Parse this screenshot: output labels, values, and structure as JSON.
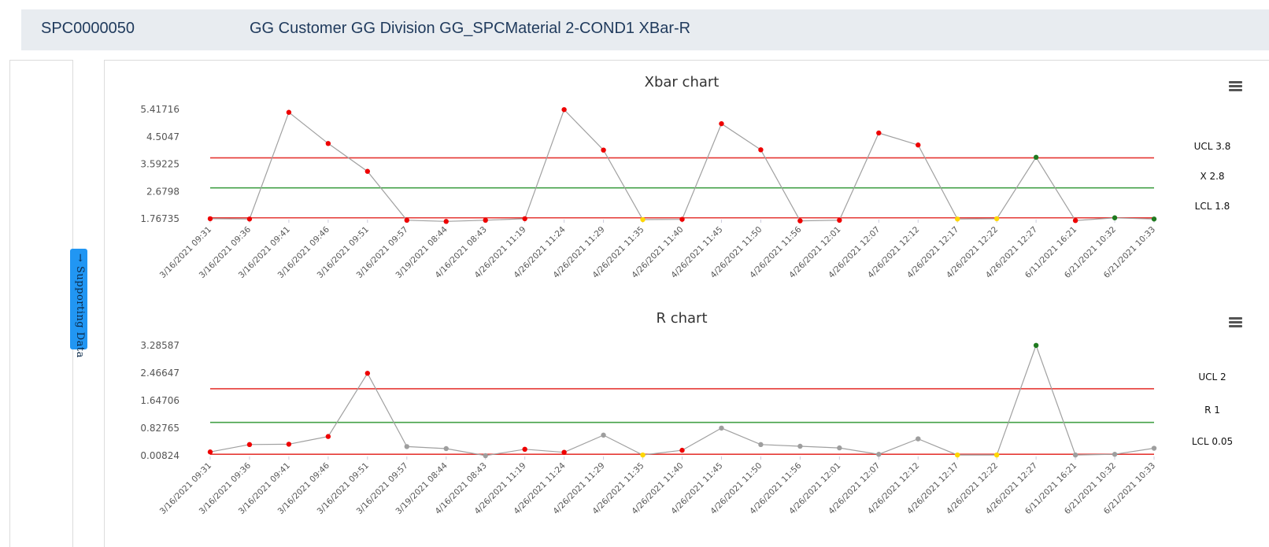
{
  "header": {
    "code": "SPC0000050",
    "title": "GG Customer GG Division GG_SPCMaterial 2-COND1 XBar-R"
  },
  "side_tab": {
    "label": "→ Supporting Data"
  },
  "colors": {
    "ucl_lcl_line": "#e53935",
    "center_line": "#43a047",
    "series_line": "#a0a0a0",
    "point_red": "#ee0000",
    "point_yellow": "#ffd700",
    "point_green": "#1f7a1f",
    "point_gray": "#9e9e9e"
  },
  "chart_data": [
    {
      "type": "line",
      "title": "Xbar chart",
      "menu_icon": "hamburger-menu-icon",
      "categories": [
        "3/16/2021 09:31",
        "3/16/2021 09:36",
        "3/16/2021 09:41",
        "3/16/2021 09:46",
        "3/16/2021 09:51",
        "3/16/2021 09:57",
        "3/19/2021 08:44",
        "4/16/2021 08:43",
        "4/26/2021 11:19",
        "4/26/2021 11:24",
        "4/26/2021 11:29",
        "4/26/2021 11:35",
        "4/26/2021 11:40",
        "4/26/2021 11:45",
        "4/26/2021 11:50",
        "4/26/2021 11:56",
        "4/26/2021 12:01",
        "4/26/2021 12:07",
        "4/26/2021 12:12",
        "4/26/2021 12:17",
        "4/26/2021 12:22",
        "4/26/2021 12:27",
        "6/11/2021 16:21",
        "6/21/2021 10:32",
        "6/21/2021 10:33"
      ],
      "values": [
        1.77,
        1.76,
        5.32,
        4.28,
        3.35,
        1.72,
        1.68,
        1.72,
        1.77,
        5.41,
        4.06,
        1.74,
        1.75,
        4.94,
        4.07,
        1.7,
        1.72,
        4.63,
        4.23,
        1.76,
        1.77,
        3.82,
        1.71,
        1.8,
        1.76
      ],
      "point_colors": [
        "red",
        "red",
        "red",
        "red",
        "red",
        "red",
        "red",
        "red",
        "red",
        "red",
        "red",
        "yellow",
        "red",
        "red",
        "red",
        "red",
        "red",
        "red",
        "red",
        "yellow",
        "yellow",
        "green",
        "red",
        "green",
        "green"
      ],
      "ytick_labels": [
        "5.41716",
        "4.5047",
        "3.59225",
        "2.6798",
        "1.76735"
      ],
      "ylim": [
        1.76735,
        5.41716
      ],
      "control_limits": [
        {
          "name": "UCL",
          "value": 3.8,
          "label": "UCL 3.8",
          "kind": "limit"
        },
        {
          "name": "X",
          "value": 2.8,
          "label": "X 2.8",
          "kind": "center"
        },
        {
          "name": "LCL",
          "value": 1.8,
          "label": "LCL 1.8",
          "kind": "limit"
        }
      ]
    },
    {
      "type": "line",
      "title": "R chart",
      "menu_icon": "hamburger-menu-icon",
      "categories": [
        "3/16/2021 09:31",
        "3/16/2021 09:36",
        "3/16/2021 09:41",
        "3/16/2021 09:46",
        "3/16/2021 09:51",
        "3/16/2021 09:57",
        "3/19/2021 08:44",
        "4/16/2021 08:43",
        "4/26/2021 11:19",
        "4/26/2021 11:24",
        "4/26/2021 11:29",
        "4/26/2021 11:35",
        "4/26/2021 11:40",
        "4/26/2021 11:45",
        "4/26/2021 11:50",
        "4/26/2021 11:56",
        "4/26/2021 12:01",
        "4/26/2021 12:07",
        "4/26/2021 12:12",
        "4/26/2021 12:17",
        "4/26/2021 12:22",
        "4/26/2021 12:27",
        "6/11/2021 16:21",
        "6/21/2021 10:32",
        "6/21/2021 10:33"
      ],
      "values": [
        0.12,
        0.34,
        0.35,
        0.58,
        2.46,
        0.28,
        0.22,
        0.01,
        0.2,
        0.11,
        0.62,
        0.03,
        0.17,
        0.83,
        0.34,
        0.29,
        0.24,
        0.05,
        0.51,
        0.03,
        0.03,
        3.29,
        0.03,
        0.05,
        0.23
      ],
      "point_colors": [
        "red",
        "red",
        "red",
        "red",
        "red",
        "gray",
        "gray",
        "gray",
        "red",
        "red",
        "gray",
        "yellow",
        "red",
        "gray",
        "gray",
        "gray",
        "gray",
        "gray",
        "gray",
        "yellow",
        "yellow",
        "green",
        "gray",
        "gray",
        "gray"
      ],
      "ytick_labels": [
        "3.28587",
        "2.46647",
        "1.64706",
        "0.82765",
        "0.00824"
      ],
      "ylim": [
        0.00824,
        3.28587
      ],
      "control_limits": [
        {
          "name": "UCL",
          "value": 2,
          "label": "UCL 2",
          "kind": "limit"
        },
        {
          "name": "R",
          "value": 1,
          "label": "R 1",
          "kind": "center"
        },
        {
          "name": "LCL",
          "value": 0.05,
          "label": "LCL 0.05",
          "kind": "limit"
        }
      ]
    }
  ]
}
